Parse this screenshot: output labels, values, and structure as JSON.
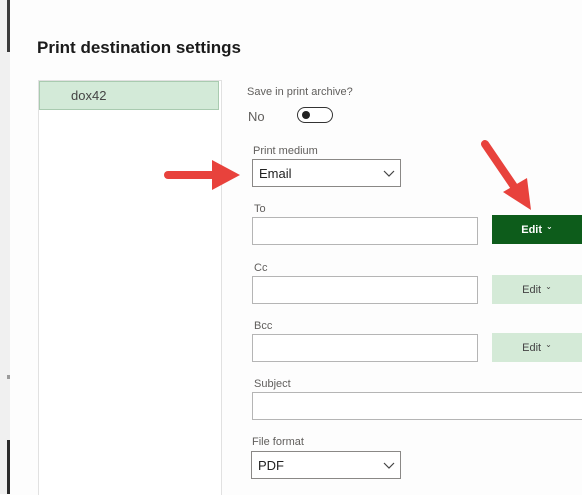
{
  "page": {
    "title": "Print destination settings"
  },
  "destinations": {
    "items": [
      {
        "label": "dox42",
        "selected": true
      }
    ]
  },
  "form": {
    "archive": {
      "label": "Save in print archive?",
      "value_text": "No",
      "checked": false
    },
    "print_medium": {
      "label": "Print medium",
      "value": "Email"
    },
    "to": {
      "label": "To",
      "value": "",
      "edit_label": "Edit",
      "edit_style": "primary"
    },
    "cc": {
      "label": "Cc",
      "value": "",
      "edit_label": "Edit",
      "edit_style": "secondary"
    },
    "bcc": {
      "label": "Bcc",
      "value": "",
      "edit_label": "Edit",
      "edit_style": "secondary"
    },
    "subject": {
      "label": "Subject",
      "value": ""
    },
    "file_format": {
      "label": "File format",
      "value": "PDF"
    }
  },
  "icons": {
    "dropdown": "chevron-down-icon",
    "edit_caret": "caret-down-icon",
    "annotation": "red-arrow-icon"
  },
  "colors": {
    "primary_green": "#0d5c1b",
    "secondary_green": "#d4ead7",
    "selected_row": "#d3ead8",
    "annotation_red": "#e8423c"
  }
}
